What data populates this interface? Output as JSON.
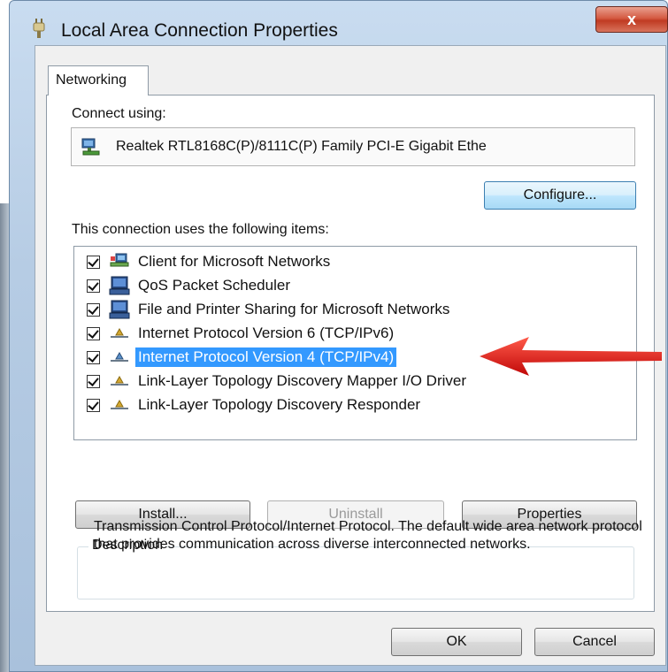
{
  "window": {
    "title": "Local Area Connection Properties",
    "close_glyph": "x",
    "icon": "network-plug-icon"
  },
  "tabs": [
    {
      "label": "Networking",
      "selected": true
    }
  ],
  "connect_using": {
    "label": "Connect using:",
    "adapter_name": "Realtek RTL8168C(P)/8111C(P) Family PCI-E Gigabit Ethe",
    "adapter_icon": "network-adapter-icon",
    "configure_label": "Configure..."
  },
  "items_section": {
    "label": "This connection uses the following items:",
    "items": [
      {
        "label": "Client for Microsoft Networks",
        "checked": true,
        "icon": "network-client-icon",
        "selected": false
      },
      {
        "label": "QoS Packet Scheduler",
        "checked": true,
        "icon": "computer-service-icon",
        "selected": false
      },
      {
        "label": "File and Printer Sharing for Microsoft Networks",
        "checked": true,
        "icon": "computer-service-icon",
        "selected": false
      },
      {
        "label": "Internet Protocol Version 6 (TCP/IPv6)",
        "checked": true,
        "icon": "protocol-icon",
        "selected": false
      },
      {
        "label": "Internet Protocol Version 4 (TCP/IPv4)",
        "checked": true,
        "icon": "protocol-icon",
        "selected": true
      },
      {
        "label": "Link-Layer Topology Discovery Mapper I/O Driver",
        "checked": true,
        "icon": "protocol-icon",
        "selected": false
      },
      {
        "label": "Link-Layer Topology Discovery Responder",
        "checked": true,
        "icon": "protocol-icon",
        "selected": false
      }
    ]
  },
  "item_buttons": {
    "install": "Install...",
    "uninstall": "Uninstall",
    "properties": "Properties"
  },
  "description": {
    "legend": "Description",
    "text": "Transmission Control Protocol/Internet Protocol. The default wide area network protocol that provides communication across diverse interconnected networks."
  },
  "dialog_buttons": {
    "ok": "OK",
    "cancel": "Cancel"
  },
  "colors": {
    "selection": "#3399ff",
    "annotation_arrow": "#e01010"
  }
}
